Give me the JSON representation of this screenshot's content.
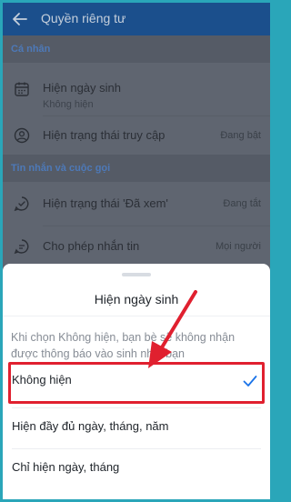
{
  "header": {
    "title": "Quyền riêng tư"
  },
  "sections": [
    {
      "title": "Cá nhân",
      "rows": [
        {
          "label": "Hiện ngày sinh",
          "sub": "Không hiện",
          "icon": "calendar-icon"
        },
        {
          "label": "Hiện trạng thái truy cập",
          "value": "Đang bật",
          "icon": "user-status-icon"
        }
      ]
    },
    {
      "title": "Tin nhắn và cuộc gọi",
      "rows": [
        {
          "label": "Hiện trạng thái 'Đã xem'",
          "value": "Đang tắt",
          "icon": "message-seen-icon"
        },
        {
          "label": "Cho phép nhắn tin",
          "value": "Mọi người",
          "icon": "chat-icon"
        }
      ]
    }
  ],
  "sheet": {
    "title": "Hiện ngày sinh",
    "description": "Khi chọn Không hiện, bạn bè sẽ không nhận được thông báo vào sinh nhật bạn",
    "options": [
      {
        "label": "Không hiện",
        "selected": true
      },
      {
        "label": "Hiện đầy đủ ngày, tháng, năm",
        "selected": false
      },
      {
        "label": "Chỉ hiện ngày, tháng",
        "selected": false
      }
    ]
  },
  "colors": {
    "app_bar": "#1b4f8c",
    "overlay": "#5f6570",
    "section_header": "#4d79b8",
    "check": "#1a73e8",
    "annotation": "#e0202f",
    "outer_border": "#2aa6b9"
  }
}
